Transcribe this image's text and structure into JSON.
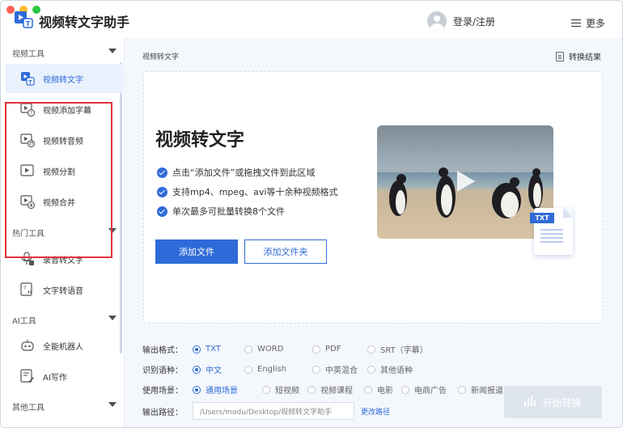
{
  "app": {
    "title": "视频转文字助手"
  },
  "header": {
    "login_label": "登录/注册",
    "more_label": "更多"
  },
  "sidebar": {
    "sections": [
      {
        "title": "视频工具",
        "items": [
          {
            "label": "视频转文字",
            "icon": "video-to-text-icon"
          },
          {
            "label": "视频添加字幕",
            "icon": "subtitle-icon"
          },
          {
            "label": "视频转音频",
            "icon": "video-to-audio-icon"
          },
          {
            "label": "视频分割",
            "icon": "video-split-icon"
          },
          {
            "label": "视频合并",
            "icon": "video-merge-icon"
          }
        ]
      },
      {
        "title": "热门工具",
        "items": [
          {
            "label": "录音转文字",
            "icon": "recording-icon"
          },
          {
            "label": "文字转语音",
            "icon": "text-to-speech-icon"
          }
        ]
      },
      {
        "title": "AI工具",
        "items": [
          {
            "label": "全能机器人",
            "icon": "robot-icon"
          },
          {
            "label": "AI写作",
            "icon": "ai-writing-icon"
          }
        ]
      },
      {
        "title": "其他工具",
        "items": []
      }
    ]
  },
  "main": {
    "breadcrumb": "视频转文字",
    "result_link": "转换结果",
    "card": {
      "title": "视频转文字",
      "features": [
        "点击“添加文件”或拖拽文件到此区域",
        "支持mp4、mpeg、avi等十余种视频格式",
        "单次最多可批量转换8个文件"
      ],
      "add_file": "添加文件",
      "add_folder": "添加文件夹",
      "txt_badge": "TXT"
    },
    "options": {
      "format": {
        "label": "输出格式：",
        "options": [
          "TXT",
          "WORD",
          "PDF",
          "SRT（字幕）"
        ],
        "selected": "TXT"
      },
      "language": {
        "label": "识别语种：",
        "options": [
          "中文",
          "English",
          "中英混合",
          "其他语种"
        ],
        "selected": "中文"
      },
      "scene": {
        "label": "使用场景：",
        "options": [
          "通用场景",
          "短视频",
          "视频课程",
          "电影",
          "电商广告",
          "新闻报道"
        ],
        "selected": "通用场景"
      },
      "path": {
        "label": "输出路径：",
        "value": "/Users/modu/Desktop/视频转文字助手",
        "change_label": "更改路径"
      }
    },
    "start_button": "开始转换"
  },
  "colors": {
    "accent": "#2f6bd8",
    "highlight": "#e0323c"
  }
}
